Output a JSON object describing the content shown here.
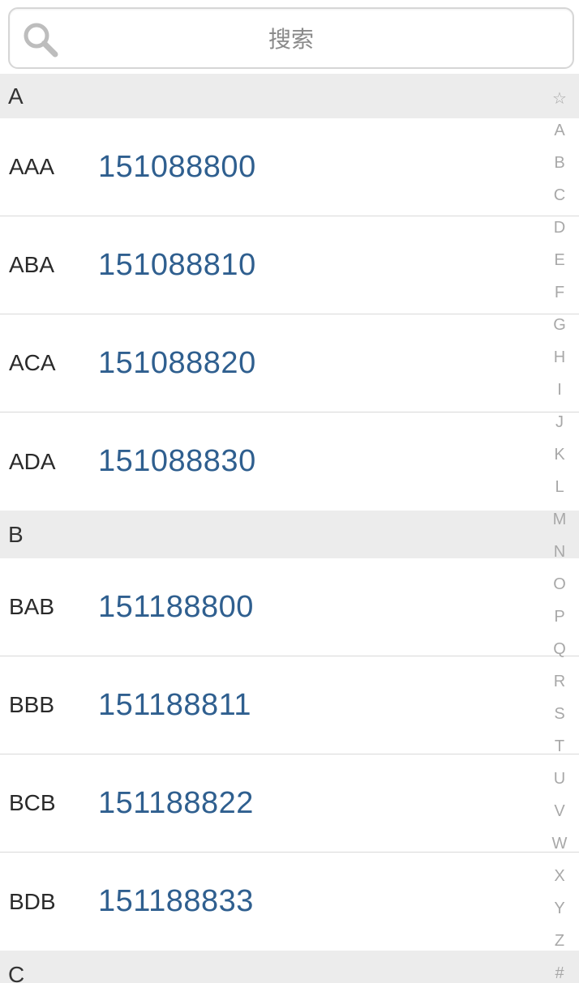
{
  "search": {
    "placeholder": "搜索"
  },
  "sections": [
    {
      "header": "A",
      "rows": [
        {
          "name": "AAA",
          "number": "151088800"
        },
        {
          "name": "ABA",
          "number": "151088810"
        },
        {
          "name": "ACA",
          "number": "151088820"
        },
        {
          "name": "ADA",
          "number": "151088830"
        }
      ]
    },
    {
      "header": "B",
      "rows": [
        {
          "name": "BAB",
          "number": "151188800"
        },
        {
          "name": "BBB",
          "number": "151188811"
        },
        {
          "name": "BCB",
          "number": "151188822"
        },
        {
          "name": "BDB",
          "number": "151188833"
        }
      ]
    },
    {
      "header": "C",
      "rows": []
    }
  ],
  "index": [
    "☆",
    "A",
    "B",
    "C",
    "D",
    "E",
    "F",
    "G",
    "H",
    "I",
    "J",
    "K",
    "L",
    "M",
    "N",
    "O",
    "P",
    "Q",
    "R",
    "S",
    "T",
    "U",
    "V",
    "W",
    "X",
    "Y",
    "Z",
    "#"
  ],
  "colors": {
    "number": "#2f5f8f",
    "section_bg": "#ececec",
    "index_text": "#a8a8a8"
  }
}
